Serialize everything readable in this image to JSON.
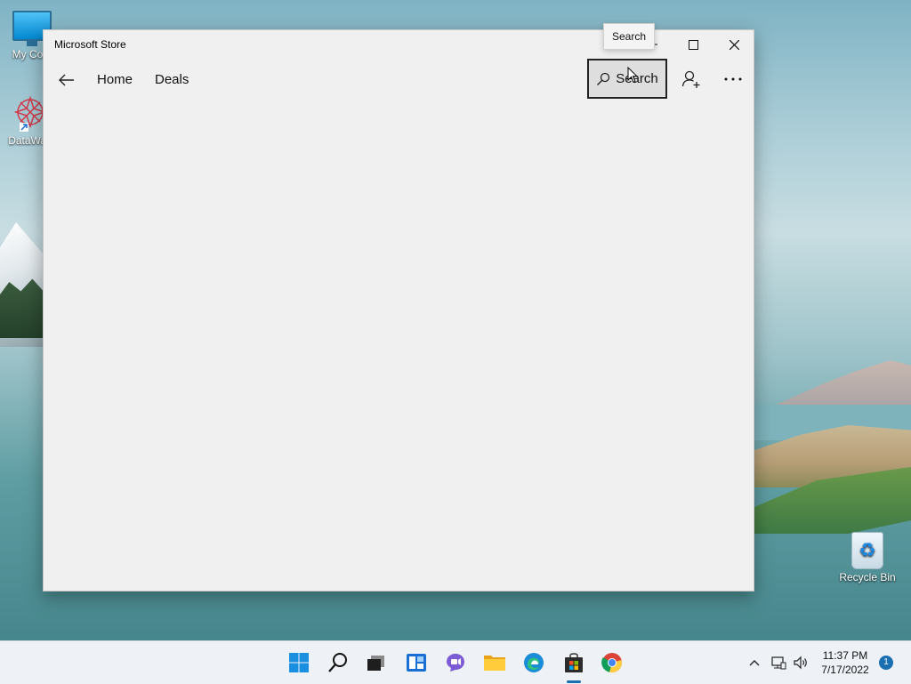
{
  "desktop": {
    "icons": [
      {
        "label": "My Com"
      },
      {
        "label": "DataWag"
      },
      {
        "label": "Recycle Bin"
      }
    ]
  },
  "window": {
    "title": "Microsoft Store",
    "nav": {
      "home": "Home",
      "deals": "Deals",
      "search": "Search"
    },
    "tooltip": "Search"
  },
  "taskbar": {
    "apps": [
      "start-icon",
      "search-icon",
      "task-view-icon",
      "widgets-icon",
      "chat-icon",
      "file-explorer-icon",
      "edge-icon",
      "store-icon",
      "chrome-icon"
    ],
    "time": "11:37 PM",
    "date": "7/17/2022",
    "notification_count": "1"
  },
  "colors": {
    "accent": "#1a6fb0",
    "window_bg": "#f0f0f0",
    "taskbar_bg": "#eef1f6"
  }
}
